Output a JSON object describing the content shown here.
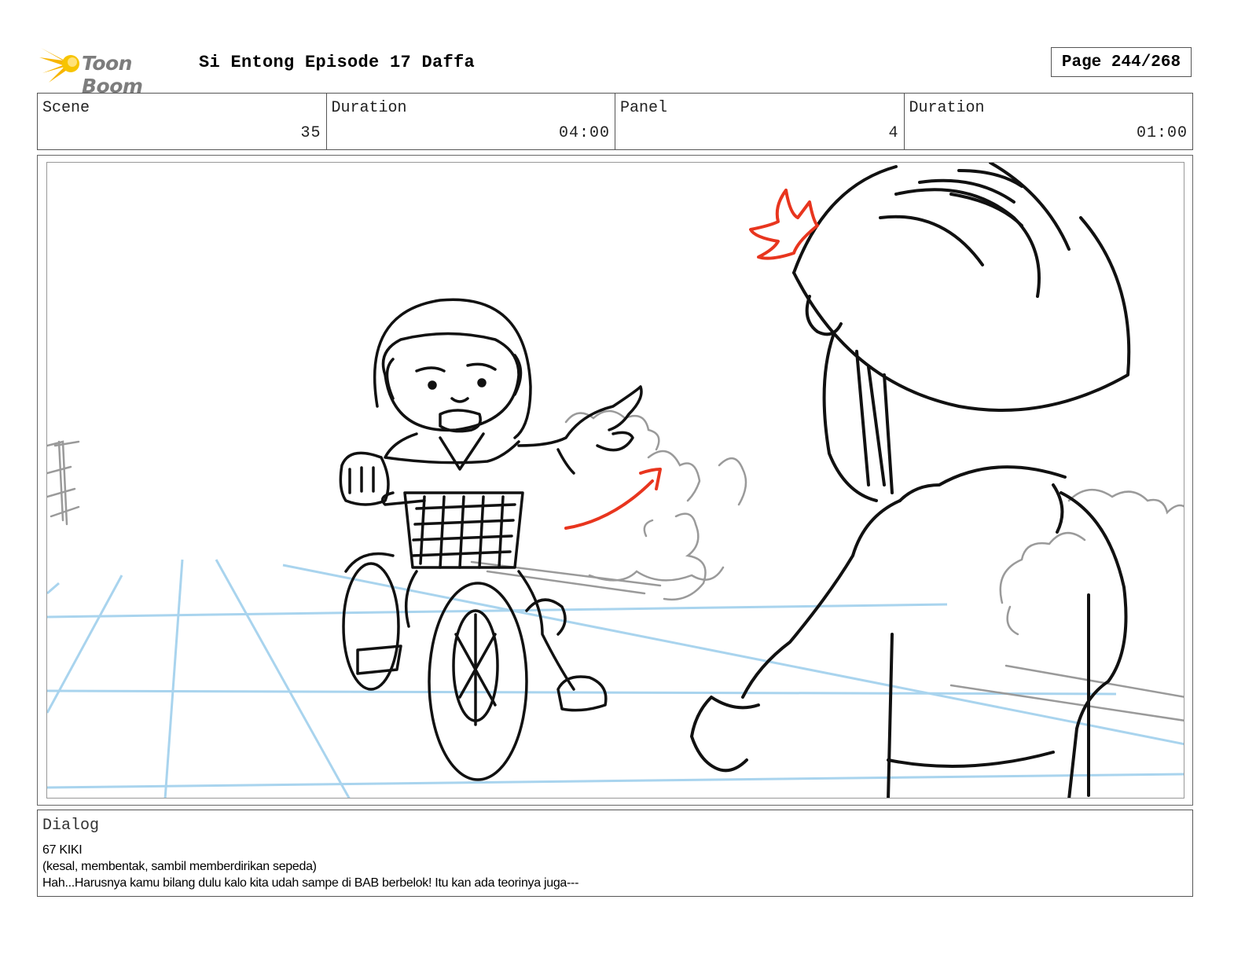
{
  "header": {
    "logo_text": "Toon Boom",
    "title": "Si Entong Episode 17 Daffa",
    "page": "Page 244/268"
  },
  "info": [
    {
      "label": "Scene",
      "value": "35"
    },
    {
      "label": "Duration",
      "value": "04:00"
    },
    {
      "label": "Panel",
      "value": "4"
    },
    {
      "label": "Duration",
      "value": "01:00"
    }
  ],
  "dialog": {
    "label": "Dialog",
    "lines": [
      "67 KIKI",
      "(kesal, membentak, sambil memberdirikan sepeda)",
      "Hah...Harusnya kamu bilang dulu kalo kita udah sampe di BAB berbelok! Itu kan ada teorinya juga---"
    ]
  },
  "colors": {
    "sketch": "#111111",
    "guides": "#a9d4ee",
    "smoke": "#9a9a9a",
    "accent": "#e8351e",
    "logo_yellow": "#f7b500"
  },
  "icons": [
    "toon-boom-logo-icon"
  ]
}
